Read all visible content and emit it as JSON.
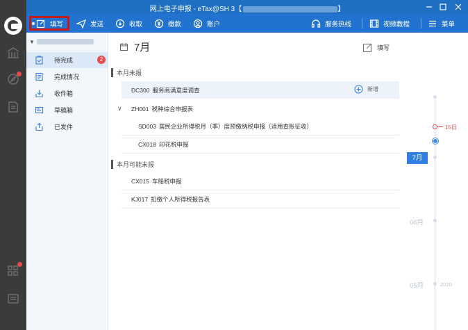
{
  "window": {
    "title": "网上电子申报 - eTax@SH 3【",
    "title_suffix": "】"
  },
  "toolbar": {
    "fill": "填写",
    "send": "发送",
    "receive": "收取",
    "pay": "缴款",
    "account": "账户",
    "hotline": "服务热线",
    "tutorial": "视频教程",
    "menu": "菜单"
  },
  "sidebar": {
    "items": [
      {
        "label": "待完成",
        "badge": "2",
        "icon": "clipboard-check-icon"
      },
      {
        "label": "完成情况",
        "icon": "list-doc-icon"
      },
      {
        "label": "收件箱",
        "icon": "inbox-download-icon"
      },
      {
        "label": "草稿箱",
        "icon": "draft-icon"
      },
      {
        "label": "已发件",
        "icon": "share-icon"
      }
    ]
  },
  "main": {
    "month": "7月",
    "fill_label": "填写",
    "sections": [
      {
        "label": "本月未报"
      },
      {
        "label": "本月可能未报"
      }
    ],
    "rows": [
      {
        "code": "DC300",
        "name": "服务商满意度调查",
        "add": "新增"
      },
      {
        "code": "ZH001",
        "name": "税种综合申报表"
      },
      {
        "code": "SD003",
        "name": "居民企业所得税月（季）度预缴纳税申报（适用查账征收）"
      },
      {
        "code": "CX018",
        "name": "印花税申报"
      },
      {
        "code": "CX015",
        "name": "车船税申报"
      },
      {
        "code": "KJ017",
        "name": "扣缴个人所得税报告表"
      }
    ]
  },
  "timeline": {
    "day_marker": "15日",
    "current_month": "7月",
    "months": [
      "06月",
      "05月"
    ],
    "year": "2020"
  },
  "colors": {
    "titlebar": "#1f6fc5",
    "toolbar": "#2273cf",
    "rail": "#3b3b3b",
    "highlight_border": "#c41a1a",
    "badge": "#e64c4c",
    "accent": "#2f80e0"
  }
}
